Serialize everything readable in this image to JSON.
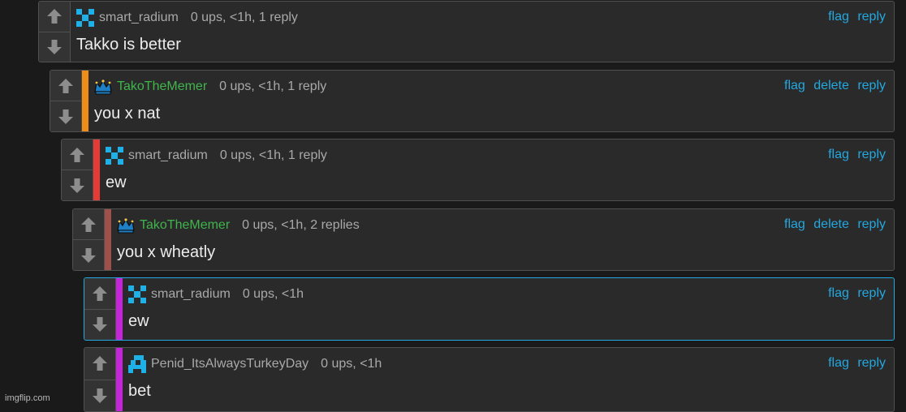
{
  "colors": {
    "background": "#1a1a1a",
    "card": "#2a2a2a",
    "link": "#23a8e0",
    "username_green": "#3fb54c",
    "depth_bars": [
      "#f08c18",
      "#e53b36",
      "#a0504b",
      "#c524d8",
      "#c524d8"
    ]
  },
  "comments": [
    {
      "username": "smart_radium",
      "stats": "0 ups, <1h, 1 reply",
      "text": "Takko is better",
      "avatar_icon": "pixel-avatar-icon",
      "actions": {
        "flag": "flag",
        "reply": "reply"
      }
    },
    {
      "username": "TakoTheMemer",
      "stats": "0 ups, <1h, 1 reply",
      "text": "you x nat",
      "avatar_icon": "crown-icon",
      "actions": {
        "flag": "flag",
        "delete": "delete",
        "reply": "reply"
      }
    },
    {
      "username": "smart_radium",
      "stats": "0 ups, <1h, 1 reply",
      "text": "ew",
      "avatar_icon": "pixel-avatar-icon",
      "actions": {
        "flag": "flag",
        "reply": "reply"
      }
    },
    {
      "username": "TakoTheMemer",
      "stats": "0 ups, <1h, 2 replies",
      "text": "you x wheatly",
      "avatar_icon": "crown-icon",
      "actions": {
        "flag": "flag",
        "delete": "delete",
        "reply": "reply"
      }
    },
    {
      "username": "smart_radium",
      "stats": "0 ups, <1h",
      "text": "ew",
      "avatar_icon": "pixel-avatar-icon",
      "actions": {
        "flag": "flag",
        "reply": "reply"
      }
    },
    {
      "username": "Penid_ItsAlwaysTurkeyDay",
      "stats": "0 ups, <1h",
      "text": "bet",
      "avatar_icon": "pixel-avatar-icon",
      "actions": {
        "flag": "flag",
        "reply": "reply"
      }
    }
  ],
  "watermark": "imgflip.com"
}
